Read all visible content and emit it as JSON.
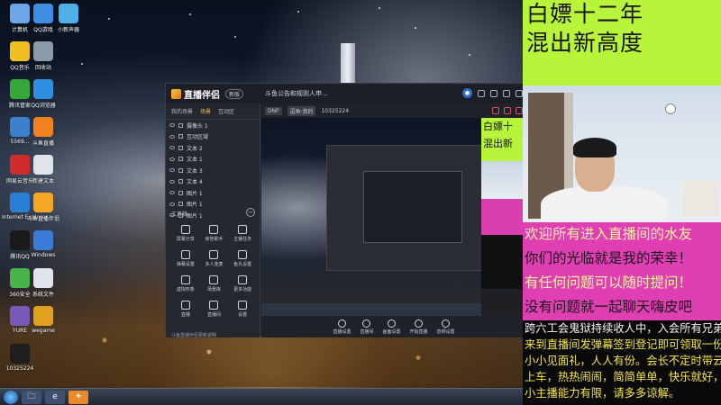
{
  "desktop": {
    "icons": [
      {
        "label": "计算机",
        "icon": "computer-icon",
        "color": "#6aa6e8"
      },
      {
        "label": "QQ游戏",
        "icon": "qq-game-icon",
        "color": "#3d8ee0"
      },
      {
        "label": "小新声器",
        "icon": "app-icon",
        "color": "#4fb0e8"
      },
      {
        "label": "QQ音乐",
        "icon": "qq-music-icon",
        "color": "#f0c020"
      },
      {
        "label": "回收站",
        "icon": "recycle-bin-icon",
        "color": "#8a9aa8"
      },
      {
        "label": "腾讯管家",
        "icon": "tencent-pc-manager-icon",
        "color": "#36a83a"
      },
      {
        "label": "QQ浏览器",
        "icon": "qq-browser-icon",
        "color": "#2f8fe0"
      },
      {
        "label": "5569...",
        "icon": "app-icon",
        "color": "#3f7fd0"
      },
      {
        "label": "斗鱼直播",
        "icon": "douyu-icon",
        "color": "#f08020"
      },
      {
        "label": "网易云音乐",
        "icon": "netease-music-icon",
        "color": "#d22b2b"
      },
      {
        "label": "新建文本",
        "icon": "text-file-icon",
        "color": "#dfe4ea"
      },
      {
        "label": "Internet Explorer",
        "icon": "ie-icon",
        "color": "#2a7fd4"
      },
      {
        "label": "斗鱼直播伴侣",
        "icon": "douyu-assistant-icon",
        "color": "#f5a623"
      },
      {
        "label": "腾讯QQ",
        "icon": "qq-icon",
        "color": "#1a1a1a"
      },
      {
        "label": "Windows",
        "icon": "windows-icon",
        "color": "#3a7bd5"
      },
      {
        "label": "360安全",
        "icon": "security-icon",
        "color": "#46b44a"
      },
      {
        "label": "系统文件",
        "icon": "file-icon",
        "color": "#dfe4ea"
      },
      {
        "label": "YURE",
        "icon": "yure-icon",
        "color": "#7a5ab8"
      },
      {
        "label": "wegame",
        "icon": "wegame-icon",
        "color": "#e0a020"
      },
      {
        "label": "10325224",
        "icon": "douyu-logo-icon",
        "color": "#1e1e1e"
      }
    ]
  },
  "taskbar": {
    "apps": [
      "explorer",
      "ie",
      "douyu-assistant"
    ]
  },
  "app": {
    "title": "直播伴侣",
    "version": "新版",
    "notice": "斗鱼公告和规则人申...",
    "left_tabs": [
      "我的场景",
      "场景",
      "互动区"
    ],
    "scenes": [
      "摄像头 1",
      "互动区域",
      "文本 2",
      "文本 1",
      "文本 3",
      "文本 4",
      "图片 1",
      "图片 1",
      "图片 1"
    ],
    "tools_header": "工具箱",
    "tools": [
      {
        "label": "屏幕分享",
        "icon": "screen-share-icon"
      },
      {
        "label": "房管助手",
        "icon": "room-manager-icon"
      },
      {
        "label": "主播任务",
        "icon": "anchor-task-icon"
      },
      {
        "label": "弹幕设置",
        "icon": "danmaku-icon"
      },
      {
        "label": "多人连麦",
        "icon": "multi-mic-icon"
      },
      {
        "label": "鱼丸设置",
        "icon": "fishball-icon"
      },
      {
        "label": "虚拟形象",
        "icon": "avatar-icon"
      },
      {
        "label": "场景库",
        "icon": "scene-library-icon"
      },
      {
        "label": "更多功能",
        "icon": "more-icon"
      },
      {
        "label": "直播",
        "icon": "live-icon"
      },
      {
        "label": "直播间",
        "icon": "room-icon"
      },
      {
        "label": "设置",
        "icon": "settings-icon"
      }
    ],
    "tool_note": "斗鱼直播伴侣更新说明",
    "toolbar_pills": [
      "DNF",
      "逗鱼·我的",
      "10325224"
    ],
    "control_items": [
      {
        "label": "直播设置",
        "icon": "live-settings-icon"
      },
      {
        "label": "直播间",
        "icon": "room-icon"
      },
      {
        "label": "画面设置",
        "icon": "picture-settings-icon"
      },
      {
        "label": "开始直播",
        "icon": "mic-icon"
      },
      {
        "label": "音频设置",
        "icon": "audio-icon"
      }
    ]
  },
  "overlay": {
    "banner_lines": [
      "白嫖十二年",
      "混出新高度"
    ],
    "banner_color": "#b8f53a",
    "pink_lines": [
      "欢迎所有进入直播间的水友",
      "你们的光临就是我的荣幸！",
      "有任何问题可以随时提问！",
      "没有问题就一起聊天嗨皮吧"
    ],
    "pink_color": "#e03fb4",
    "black_lines": [
      "跨六工会鬼狱持续收人中，入会所有兄弟",
      "来到直播间发弹幕签到登记即可领取一份",
      "小小见面礼，人人有份。会长不定时带云",
      "上车，热热闹闹，简简单单，快乐就好，",
      "小主播能力有限，请多多谅解。"
    ]
  },
  "mini_preview": {
    "banner_lines": [
      "白嫖十",
      "混出新"
    ]
  }
}
